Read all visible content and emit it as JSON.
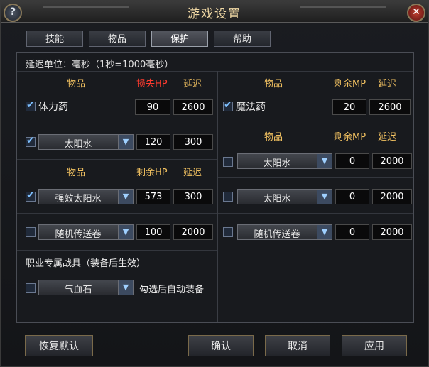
{
  "window": {
    "title": "游戏设置",
    "help_label": "?",
    "close_label": "✕"
  },
  "tabs": [
    {
      "label": "技能",
      "active": false
    },
    {
      "label": "物品",
      "active": false
    },
    {
      "label": "保护",
      "active": true
    },
    {
      "label": "帮助",
      "active": false
    }
  ],
  "delay_unit_note": "延迟单位：毫秒（1秒=1000毫秒）",
  "left": {
    "hp_header": {
      "item": "物品",
      "metric": "损失HP",
      "delay": "延迟"
    },
    "rows1": [
      {
        "checked": true,
        "name": "体力药",
        "value": "90",
        "delay": "2600"
      },
      {
        "checked": true,
        "select": "太阳水",
        "value": "120",
        "delay": "300"
      }
    ],
    "header2": {
      "item": "物品",
      "metric": "剩余HP",
      "delay": "延迟"
    },
    "rows2": [
      {
        "checked": true,
        "select": "强效太阳水",
        "value": "573",
        "delay": "300"
      },
      {
        "checked": false,
        "select": "随机传送卷",
        "value": "100",
        "delay": "2000"
      }
    ],
    "gear_title": "职业专属战具（装备后生效）",
    "gear": {
      "checked": false,
      "select": "气血石",
      "note": "勾选后自动装备"
    }
  },
  "right": {
    "header1": {
      "item": "物品",
      "metric": "剩余MP",
      "delay": "延迟"
    },
    "row_main": {
      "checked": true,
      "name": "魔法药",
      "value": "20",
      "delay": "2600"
    },
    "header2": {
      "item": "物品",
      "metric": "剩余MP",
      "delay": "延迟"
    },
    "rows": [
      {
        "checked": false,
        "select": "太阳水",
        "value": "0",
        "delay": "2000"
      },
      {
        "checked": false,
        "select": "太阳水",
        "value": "0",
        "delay": "2000"
      },
      {
        "checked": false,
        "select": "随机传送卷",
        "value": "0",
        "delay": "2000"
      }
    ]
  },
  "buttons": {
    "restore": "恢复默认",
    "ok": "确认",
    "cancel": "取消",
    "apply": "应用"
  },
  "colors": {
    "header_gold": "#f0c060",
    "loss_red": "#ff3b2f",
    "check_blue": "#7ec0ff"
  }
}
